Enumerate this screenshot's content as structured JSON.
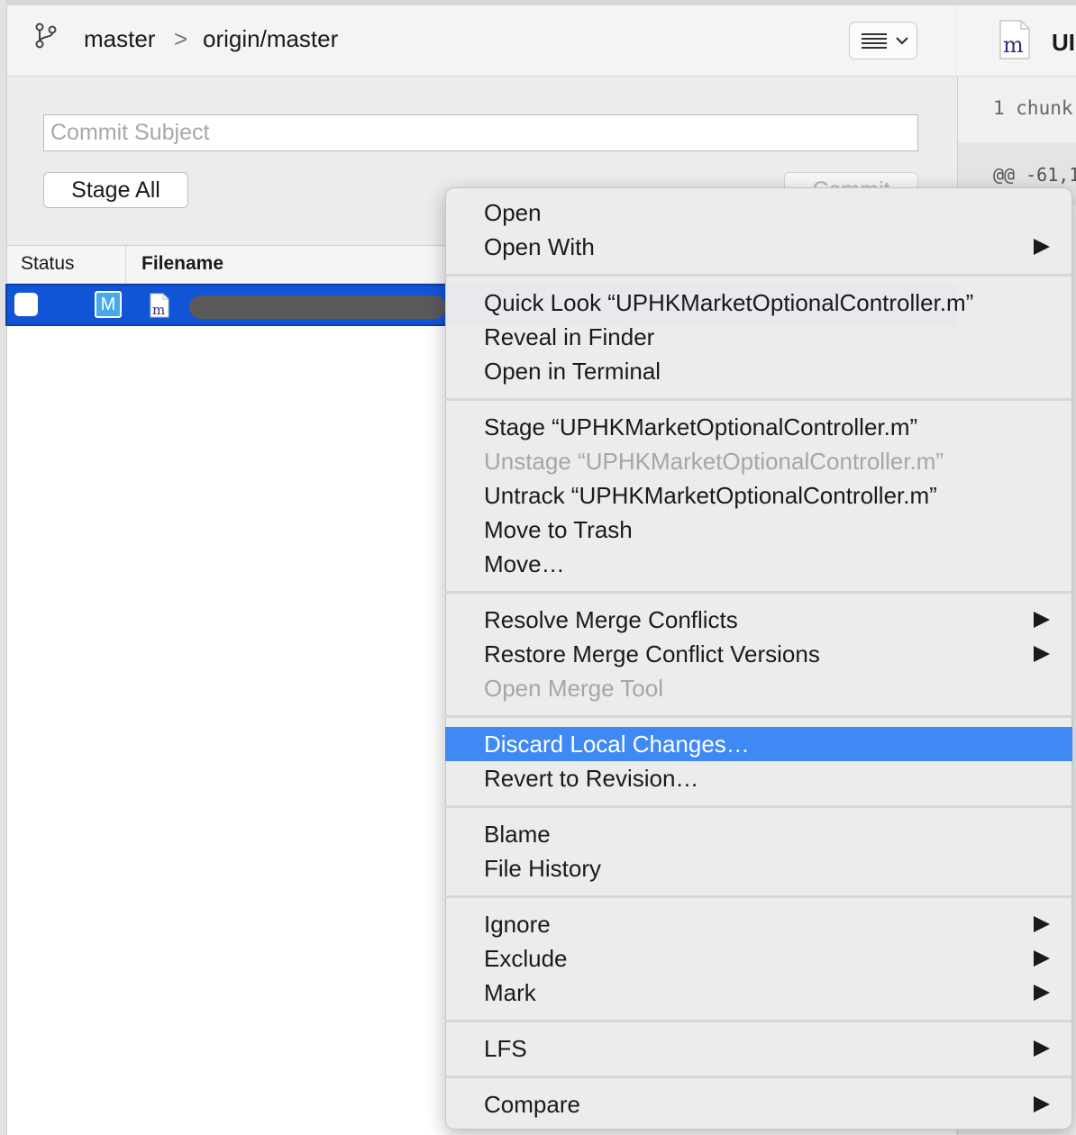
{
  "header": {
    "branch_local": "master",
    "branch_separator": ">",
    "branch_remote": "origin/master",
    "view_menu_icon": "list-icon"
  },
  "commit": {
    "subject_placeholder": "Commit Subject",
    "subject_value": "",
    "stage_all_label": "Stage All",
    "commit_label": "Commit"
  },
  "table": {
    "columns": [
      "Status",
      "Filename"
    ],
    "rows": [
      {
        "checked": false,
        "status_badge": "M",
        "file_icon_letter": "m"
      }
    ]
  },
  "diff_pane": {
    "file_icon_letter": "m",
    "file_title": "UI",
    "chunk_text": "1 chunk",
    "hunk_header": "@@ -61,1"
  },
  "context_menu": {
    "items": [
      {
        "label": "Open",
        "enabled": true,
        "submenu": false
      },
      {
        "label": "Open With",
        "enabled": true,
        "submenu": true
      },
      {
        "label": "Quick Look “UPHKMarketOptionalController.m”",
        "enabled": true,
        "submenu": false
      },
      {
        "label": "Reveal in Finder",
        "enabled": true,
        "submenu": false
      },
      {
        "label": "Open in Terminal",
        "enabled": true,
        "submenu": false
      },
      {
        "label": "Stage “UPHKMarketOptionalController.m”",
        "enabled": true,
        "submenu": false
      },
      {
        "label": "Unstage “UPHKMarketOptionalController.m”",
        "enabled": false,
        "submenu": false
      },
      {
        "label": "Untrack “UPHKMarketOptionalController.m”",
        "enabled": true,
        "submenu": false
      },
      {
        "label": "Move to Trash",
        "enabled": true,
        "submenu": false
      },
      {
        "label": "Move…",
        "enabled": true,
        "submenu": false
      },
      {
        "label": "Resolve Merge Conflicts",
        "enabled": true,
        "submenu": true
      },
      {
        "label": "Restore Merge Conflict Versions",
        "enabled": true,
        "submenu": true
      },
      {
        "label": "Open Merge Tool",
        "enabled": false,
        "submenu": false
      },
      {
        "label": "Discard Local Changes…",
        "enabled": true,
        "submenu": false,
        "highlighted": true
      },
      {
        "label": "Revert to Revision…",
        "enabled": true,
        "submenu": false
      },
      {
        "label": "Blame",
        "enabled": true,
        "submenu": false
      },
      {
        "label": "File History",
        "enabled": true,
        "submenu": false
      },
      {
        "label": "Ignore",
        "enabled": true,
        "submenu": true
      },
      {
        "label": "Exclude",
        "enabled": true,
        "submenu": true
      },
      {
        "label": "Mark",
        "enabled": true,
        "submenu": true
      },
      {
        "label": "LFS",
        "enabled": true,
        "submenu": true
      },
      {
        "label": "Compare",
        "enabled": true,
        "submenu": true
      }
    ]
  },
  "colors": {
    "selection": "#1254d6",
    "menu_highlight": "#3f89f5",
    "status_badge": "#46a9e8",
    "disabled_text": "#a6a6a6"
  }
}
